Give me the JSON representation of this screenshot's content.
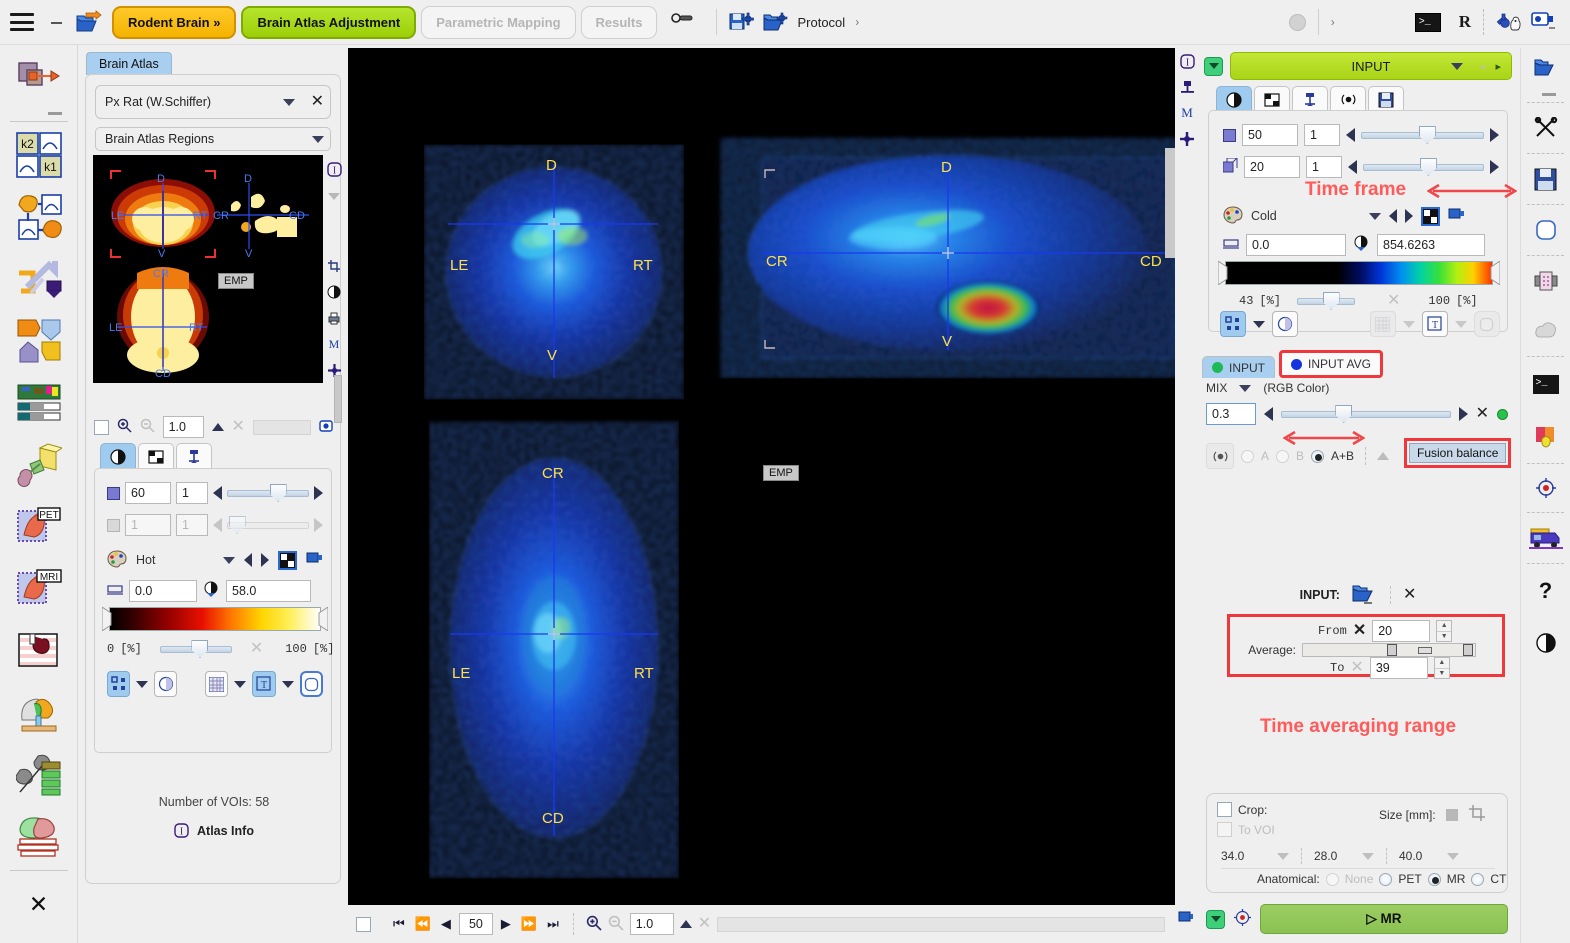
{
  "topbar": {
    "menu_icon": "hamburger-icon",
    "minimize_icon": "minimize-icon",
    "open_icon": "open-folder-arrow-icon",
    "tabs": [
      {
        "label": "Rodent Brain »",
        "style": "orange",
        "enabled": true
      },
      {
        "label": "Brain Atlas Adjustment",
        "style": "green",
        "enabled": true
      },
      {
        "label": "Parametric Mapping",
        "style": "grey",
        "enabled": false
      },
      {
        "label": "Results",
        "style": "grey",
        "enabled": false
      }
    ],
    "link_icon": "chain-link-icon",
    "save_protocol_icon": "save-protocol-icon",
    "load_protocol_icon": "open-protocol-icon",
    "protocol_label": "Protocol",
    "expand_arrow": "›",
    "console_label": ">_",
    "r_label": "R",
    "tools_icon": "tools-icon",
    "camera_icon": "capture-icon"
  },
  "rail": {
    "items": [
      {
        "name": "image-fusion",
        "label": ""
      },
      {
        "name": "kinetic-modeling-k2k1",
        "label": "k2 / k1"
      },
      {
        "name": "pixelwise-modeling",
        "label": ""
      },
      {
        "name": "curve-tool",
        "label": ""
      },
      {
        "name": "segmentation",
        "label": ""
      },
      {
        "name": "color-table-tool",
        "label": ""
      },
      {
        "name": "3d-rendering",
        "label": ""
      },
      {
        "name": "pet-cardiac",
        "label": "PET"
      },
      {
        "name": "mri-cardiac",
        "label": "MRI"
      },
      {
        "name": "cardiac-perfusion",
        "label": ""
      },
      {
        "name": "brain-tool",
        "label": ""
      },
      {
        "name": "projection-tool",
        "label": ""
      },
      {
        "name": "rodent-brain-tool",
        "label": ""
      },
      {
        "name": "close-app",
        "label": "✕"
      }
    ]
  },
  "atlas": {
    "tab_label": "Brain Atlas",
    "template_value": "Px Rat (W.Schiffer)",
    "regions_value": "Brain Atlas Regions",
    "overlay_tag": "EMP",
    "orientation_labels": {
      "d": "D",
      "v": "V",
      "le": "LE",
      "rt": "RT",
      "cr": "CR",
      "cd": "CD"
    },
    "zoom_value": "1.0",
    "voi_count_label": "Number of VOIs: 58",
    "atlas_info_label": "Atlas Info",
    "info_icon": "info-icon",
    "tabs": [
      {
        "name": "contrast-tab",
        "icon": "contrast-icon",
        "active": true
      },
      {
        "name": "layout-tab",
        "icon": "grid-icon",
        "active": false
      },
      {
        "name": "annotation-tab",
        "icon": "pin-icon",
        "active": false
      }
    ],
    "slice_value": "60",
    "slice_step": "1",
    "frame_value": "1",
    "frame_step": "1",
    "palette_name": "Hot",
    "range_min": "0.0",
    "range_max": "58.0",
    "pct_min": "0",
    "pct_max": "100",
    "pct_unit": "[%]",
    "palette_icon": "palette-icon"
  },
  "viewer": {
    "panes": [
      {
        "name": "coronal-pane",
        "labels": {
          "top": "D",
          "bottom": "V",
          "left": "LE",
          "right": "RT"
        }
      },
      {
        "name": "sagittal-pane",
        "labels": {
          "top": "D",
          "bottom": "V",
          "left": "CR",
          "right": "CD"
        }
      },
      {
        "name": "transverse-pane",
        "labels": {
          "top": "CR",
          "bottom": "CD",
          "left": "LE",
          "right": "RT"
        }
      }
    ],
    "overlay_tag": "EMP",
    "bottom": {
      "slice_value": "50",
      "zoom_value": "1.0",
      "first_icon": "first-slice-icon",
      "prev_fast_icon": "rewind-icon",
      "prev_icon": "previous-slice-icon",
      "next_icon": "next-slice-icon",
      "next_fast_icon": "forward-icon",
      "last_icon": "last-slice-icon",
      "zoom_in_icon": "zoom-in-icon",
      "zoom_out_icon": "zoom-out-icon"
    }
  },
  "viewicons": {
    "items": [
      {
        "name": "info-icon",
        "glyph": "I"
      },
      {
        "name": "reference-icon",
        "glyph": ""
      },
      {
        "name": "marker-icon",
        "glyph": "M"
      },
      {
        "name": "crosshair-icon",
        "glyph": ""
      }
    ]
  },
  "right": {
    "series_selector": {
      "value": "INPUT",
      "left_arrow": "◂",
      "right_arrow": "▸"
    },
    "tabs": [
      {
        "name": "contrast-tab",
        "icon": "contrast-icon",
        "active": true
      },
      {
        "name": "layout-tab",
        "icon": "grid-icon",
        "active": false
      },
      {
        "name": "annotation-tab",
        "icon": "pin-icon",
        "active": false
      },
      {
        "name": "fusion-tab",
        "icon": "fusion-icon",
        "active": false
      },
      {
        "name": "save-tab",
        "icon": "save-icon",
        "active": false
      }
    ],
    "slice_value": "50",
    "slice_step": "1",
    "frame_value": "20",
    "frame_step": "1",
    "time_frame_annotation": "Time frame",
    "palette_name": "Cold",
    "palette_icon": "palette-icon",
    "range_min": "0.0",
    "range_max": "854.6263",
    "pct_min": "43",
    "pct_max": "100",
    "pct_unit": "[%]",
    "layers": [
      {
        "label": "INPUT",
        "dot": "#1db954",
        "active": true
      },
      {
        "label": "INPUT AVG",
        "dot": "#1633e0",
        "active": false,
        "highlight": true
      }
    ],
    "mix_label": "MIX",
    "rgb_label": "(RGB Color)",
    "fusion_value": "0.3",
    "fusion_annotation": "Fusion balance",
    "ab_options": [
      {
        "label": "A",
        "selected": false,
        "enabled": false
      },
      {
        "label": "B",
        "selected": false,
        "enabled": false
      },
      {
        "label": "A+B",
        "selected": true,
        "enabled": true
      }
    ],
    "input_label": "INPUT:",
    "input_open_icon": "open-folder-icon",
    "input_clear_icon": "close-icon",
    "average": {
      "group_label": "Average:",
      "from_label": "From",
      "from_value": "20",
      "to_label": "To",
      "to_value": "39"
    },
    "time_avg_annotation": "Time averaging range",
    "crop": {
      "crop_label": "Crop:",
      "to_voi_label": "To VOI",
      "size_label": "Size [mm]:",
      "dim_x": "34.0",
      "dim_y": "28.0",
      "dim_z": "40.0"
    },
    "anatomical": {
      "label": "Anatomical:",
      "options": [
        {
          "label": "None",
          "selected": false,
          "enabled": false
        },
        {
          "label": "PET",
          "selected": false,
          "enabled": true
        },
        {
          "label": "MR",
          "selected": true,
          "enabled": true
        },
        {
          "label": "CT",
          "selected": false,
          "enabled": true
        }
      ]
    },
    "action_button": "▷  MR"
  },
  "rightrail": {
    "items": [
      {
        "name": "open-icon"
      },
      {
        "name": "scissors-icon"
      },
      {
        "name": "save-icon"
      },
      {
        "name": "shape-icon"
      },
      {
        "name": "matrix-icon"
      },
      {
        "name": "cloud-icon"
      },
      {
        "name": "console-icon"
      },
      {
        "name": "colorize-icon"
      },
      {
        "name": "target-icon"
      },
      {
        "name": "truck-icon"
      },
      {
        "name": "help-icon"
      },
      {
        "name": "contrast-icon"
      }
    ]
  },
  "colors": {
    "accent_green": "#a9d417",
    "accent_orange": "#fbbc05",
    "annotation_red": "#ff5b5b",
    "highlight_blue": "#9fcbef"
  }
}
